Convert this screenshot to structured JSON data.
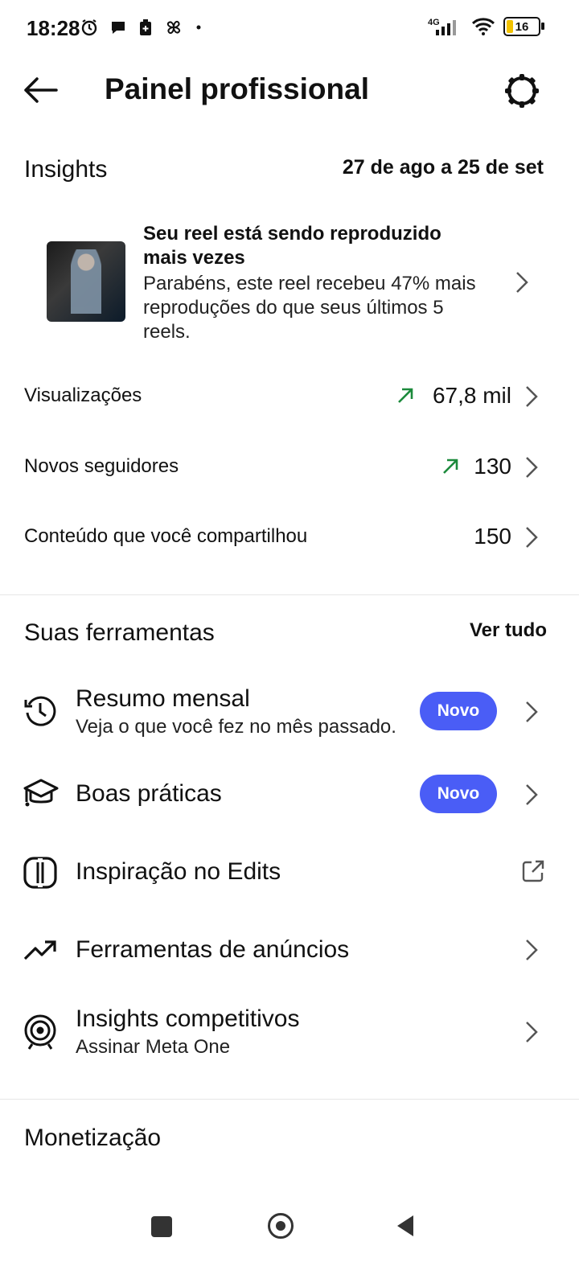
{
  "status_bar": {
    "time": "18:28",
    "network": "4G",
    "battery": "16",
    "icons_left": [
      "alarm-icon",
      "chat-icon",
      "battery-saver-icon",
      "pinwheel-icon",
      "dot-icon"
    ]
  },
  "header": {
    "title": "Painel profissional"
  },
  "insights": {
    "heading": "Insights",
    "date_range": "27 de ago a 25 de set",
    "reel_card": {
      "title": "Seu reel está sendo reproduzido mais vezes",
      "text": "Parabéns, este reel recebeu 47% mais reproduções do que seus últimos 5 reels."
    },
    "metrics": [
      {
        "label": "Visualizações",
        "value": "67,8 mil",
        "trend": "up"
      },
      {
        "label": "Novos seguidores",
        "value": "130",
        "trend": "up"
      },
      {
        "label": "Conteúdo que você compartilhou",
        "value": "150",
        "trend": ""
      }
    ]
  },
  "tools": {
    "heading": "Suas ferramentas",
    "see_all": "Ver tudo",
    "items": [
      {
        "title": "Resumo mensal",
        "subtitle": "Veja o que você fez no mês passado.",
        "badge": "Novo"
      },
      {
        "title": "Boas práticas",
        "subtitle": "",
        "badge": "Novo"
      },
      {
        "title": "Inspiração no Edits",
        "subtitle": "",
        "badge": ""
      },
      {
        "title": "Ferramentas de anúncios",
        "subtitle": "",
        "badge": ""
      },
      {
        "title": "Insights competitivos",
        "subtitle": "Assinar Meta One",
        "badge": ""
      }
    ]
  },
  "monetization": {
    "heading": "Monetização"
  },
  "colors": {
    "badge": "#4a5df6",
    "trend_up": "#1c8a3c"
  }
}
